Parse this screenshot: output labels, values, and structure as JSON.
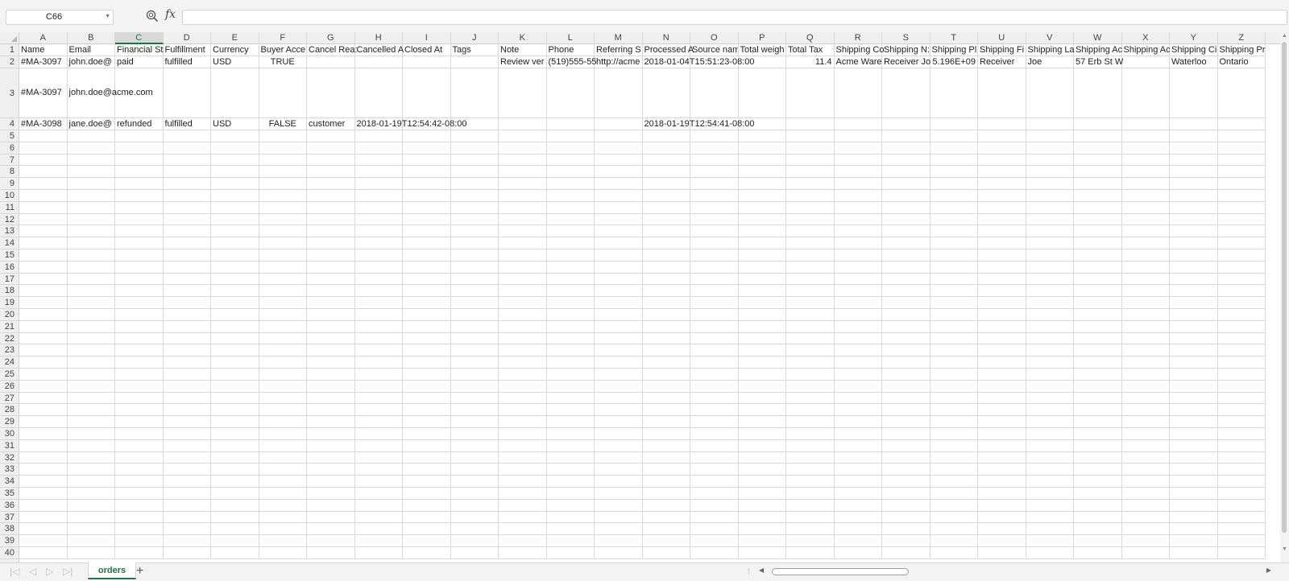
{
  "formula_bar": {
    "name_box": "C66",
    "formula": "",
    "fx_label": "fx"
  },
  "columns": [
    "A",
    "B",
    "C",
    "D",
    "E",
    "F",
    "G",
    "H",
    "I",
    "J",
    "K",
    "L",
    "M",
    "N",
    "O",
    "P",
    "Q",
    "R",
    "S",
    "T",
    "U",
    "V",
    "W",
    "X",
    "Y",
    "Z"
  ],
  "selected_column": "C",
  "rows": [
    "1",
    "2",
    "3",
    "4",
    "5",
    "6",
    "7",
    "8",
    "9",
    "10",
    "11",
    "12",
    "13",
    "14",
    "15",
    "16",
    "17",
    "18",
    "19",
    "20",
    "21",
    "22",
    "23",
    "24",
    "25",
    "26",
    "27",
    "28",
    "29",
    "30",
    "31",
    "32",
    "33",
    "34",
    "35",
    "36",
    "37",
    "38",
    "39",
    "40"
  ],
  "cells": {
    "r1": [
      "Name",
      "Email",
      "Financial St",
      "Fulfillment",
      "Currency",
      "Buyer Acce",
      "Cancel Rea:",
      "Cancelled A",
      "Closed At",
      "Tags",
      "Note",
      "Phone",
      "Referring S",
      "Processed A",
      "Source nam",
      "Total weigh",
      "Total Tax",
      "Shipping Co",
      "Shipping N:",
      "Shipping Pl",
      "Shipping Fi",
      "Shipping La",
      "Shipping Ac",
      "Shipping Ac",
      "Shipping Ci",
      "Shipping Pr"
    ],
    "r2": [
      "#MA-3097",
      "john.doe@",
      "paid",
      "fulfilled",
      "USD",
      "TRUE",
      "",
      "",
      "",
      "",
      "Review ver",
      "(519)555-55",
      "http://acme",
      "2018-01-04T15:51:23-08:00",
      "",
      "",
      "11.4",
      "Acme Ware",
      "Receiver Jo",
      "5.196E+09",
      "Receiver",
      "Joe",
      "57 Erb St W",
      "",
      "Waterloo",
      "Ontario"
    ],
    "r3": [
      "#MA-3097",
      "john.doe@acme.com",
      "",
      "",
      "",
      "",
      "",
      "",
      "",
      "",
      "",
      "",
      "",
      "",
      "",
      "",
      "",
      "",
      "",
      "",
      "",
      "",
      "",
      "",
      "",
      ""
    ],
    "r4": [
      "#MA-3098",
      "jane.doe@",
      "refunded",
      "fulfilled",
      "USD",
      "FALSE",
      "customer",
      "2018-01-19T12:54:42-08:00",
      "",
      "",
      "",
      "",
      "",
      "2018-01-19T12:54:41-08:00",
      "",
      "",
      "",
      "",
      "",
      "",
      "",
      "",
      "",
      "",
      "",
      ""
    ]
  },
  "sheet_tabs": [
    {
      "label": "orders",
      "active": true
    }
  ],
  "add_sheet_label": "+"
}
